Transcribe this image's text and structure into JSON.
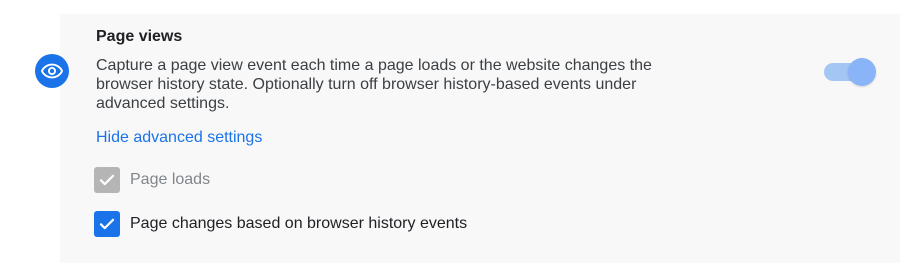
{
  "section": {
    "icon": "eye-icon",
    "title": "Page views",
    "description_lines": [
      "Capture a page view event each time a page loads or the website changes the",
      "browser history state. Optionally turn off browser history-based events under",
      "advanced settings."
    ],
    "toggle_on": true
  },
  "advanced": {
    "link_label": "Hide advanced settings",
    "options": [
      {
        "label": "Page loads",
        "checked": true,
        "disabled": true
      },
      {
        "label": "Page changes based on browser history events",
        "checked": true,
        "disabled": false
      }
    ]
  },
  "colors": {
    "accent": "#1a73e8",
    "toggle_track": "#a4c6f5",
    "toggle_thumb": "#8ab4f8",
    "disabled_checkbox": "#b5b5b5"
  }
}
